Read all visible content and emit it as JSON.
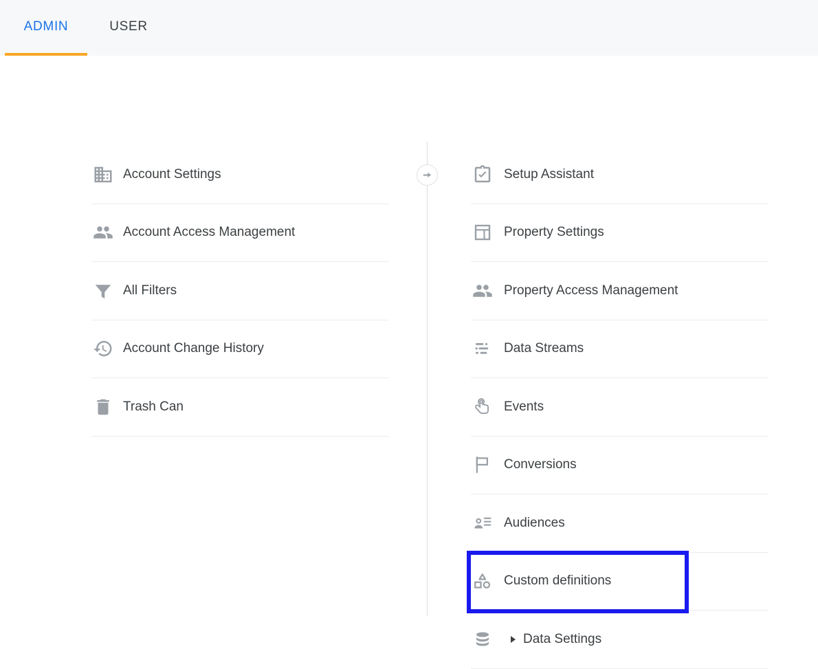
{
  "header": {
    "tabs": [
      {
        "label": "ADMIN",
        "active": true
      },
      {
        "label": "USER",
        "active": false
      }
    ],
    "active_tab_color": "#1a73e8",
    "active_underline_color": "#f9a825",
    "background": "#f6f8fa"
  },
  "switch_property_button": {
    "icon": "arrow-right-circle-icon",
    "label": ""
  },
  "account_column": {
    "items": [
      {
        "label": "Account Settings",
        "icon": "business-building-icon"
      },
      {
        "label": "Account Access Management",
        "icon": "people-group-icon"
      },
      {
        "label": "All Filters",
        "icon": "filter-funnel-icon"
      },
      {
        "label": "Account Change History",
        "icon": "history-clock-icon"
      },
      {
        "label": "Trash Can",
        "icon": "trash-can-icon"
      }
    ]
  },
  "property_column": {
    "items": [
      {
        "label": "Setup Assistant",
        "icon": "clipboard-check-icon",
        "expandable": false,
        "highlighted": false
      },
      {
        "label": "Property Settings",
        "icon": "property-layout-icon",
        "expandable": false,
        "highlighted": false
      },
      {
        "label": "Property Access Management",
        "icon": "people-group-icon",
        "expandable": false,
        "highlighted": false
      },
      {
        "label": "Data Streams",
        "icon": "data-streams-icon",
        "expandable": false,
        "highlighted": false
      },
      {
        "label": "Events",
        "icon": "touch-tap-icon",
        "expandable": false,
        "highlighted": false
      },
      {
        "label": "Conversions",
        "icon": "flag-icon",
        "expandable": false,
        "highlighted": false
      },
      {
        "label": "Audiences",
        "icon": "person-list-icon",
        "expandable": false,
        "highlighted": false
      },
      {
        "label": "Custom definitions",
        "icon": "shapes-icon",
        "expandable": false,
        "highlighted": true
      },
      {
        "label": "Data Settings",
        "icon": "database-icon",
        "expandable": true,
        "highlighted": false
      }
    ]
  },
  "annotation": {
    "highlight_color": "#1a1aee",
    "target_label": "Custom definitions"
  },
  "colors": {
    "text": "#3c4043",
    "icon": "#9aa0a6",
    "divider": "#ececec",
    "vertical_divider": "#dadce0"
  }
}
